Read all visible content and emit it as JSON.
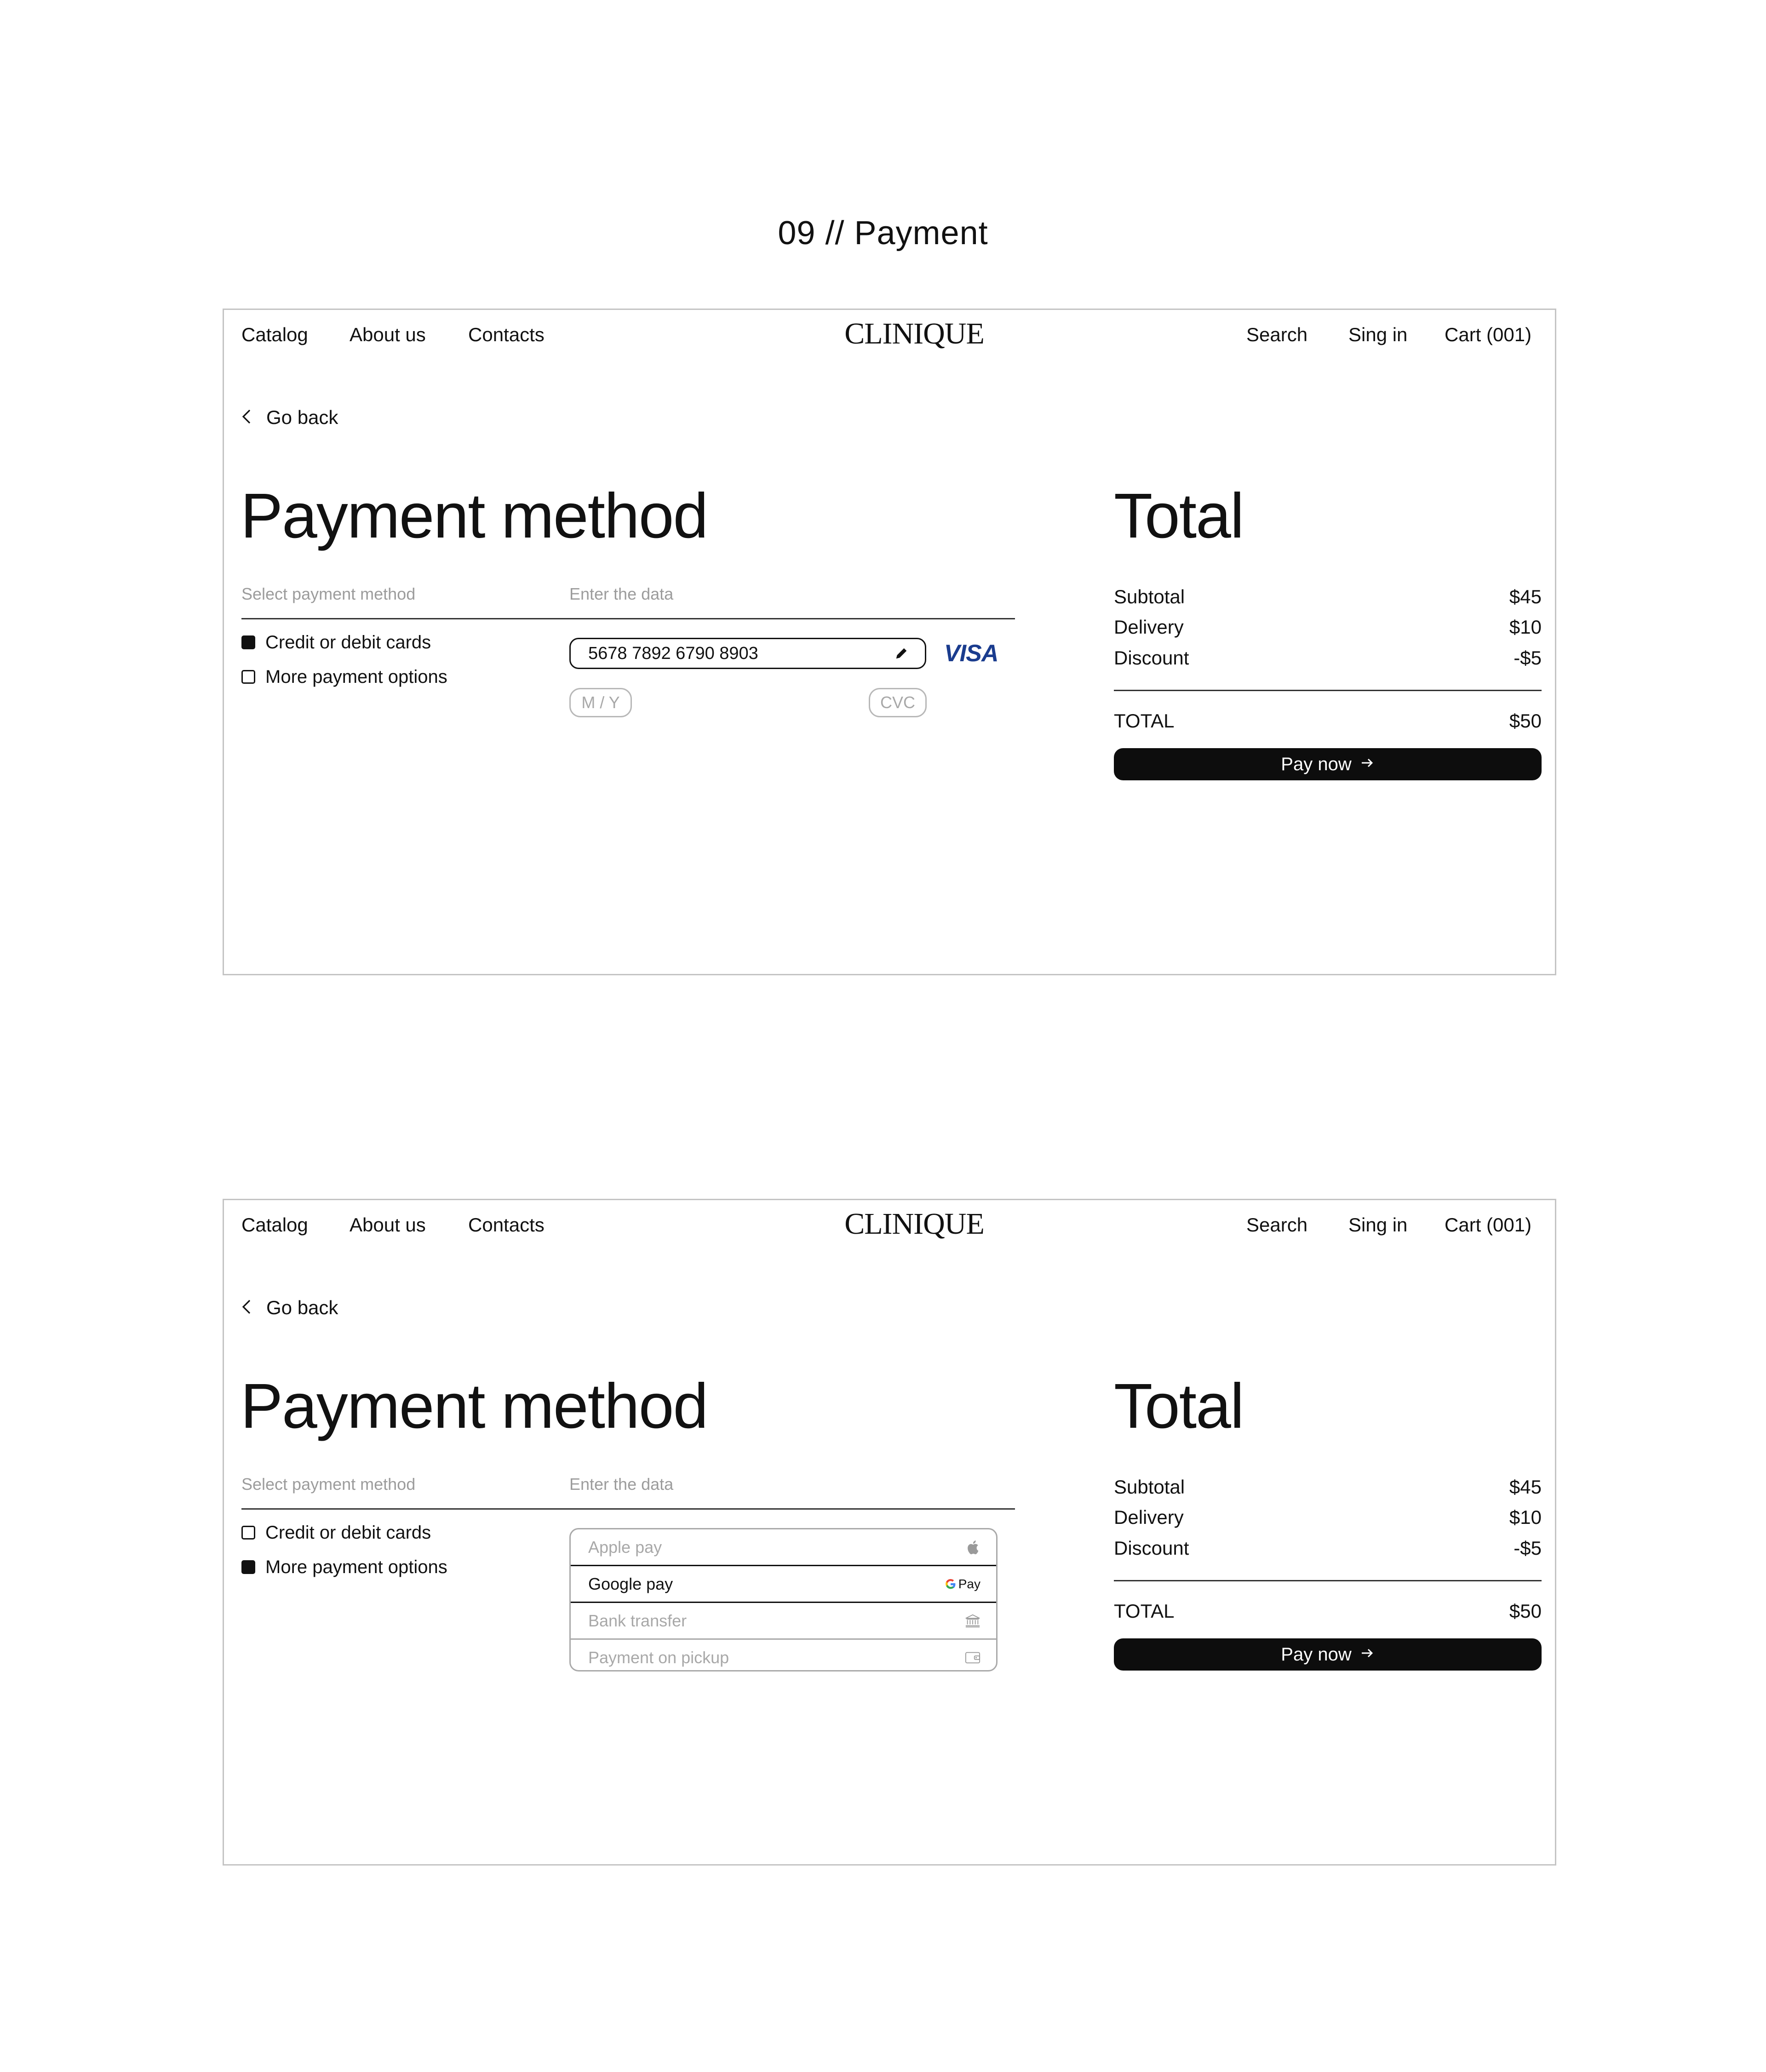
{
  "page_heading": "09 // Payment",
  "screens": [
    {
      "nav": {
        "left": [
          "Catalog",
          "About us",
          "Contacts"
        ],
        "logo": "CLINIQUE",
        "right": [
          "Search",
          "Sing in",
          "Cart (001)"
        ]
      },
      "go_back": "Go back",
      "payment_title": "Payment method",
      "total_title": "Total",
      "select_label": "Select payment method",
      "data_label": "Enter the data",
      "methods": [
        {
          "label": "Credit or debit cards",
          "checked": true
        },
        {
          "label": "More payment options",
          "checked": false
        }
      ],
      "card": {
        "number": "5678 7892 6790 8903",
        "brand": "VISA",
        "expiry_placeholder": "M / Y",
        "cvc_placeholder": "CVC"
      },
      "summary": [
        {
          "label": "Subtotal",
          "value": "$45"
        },
        {
          "label": "Delivery",
          "value": "$10"
        },
        {
          "label": "Discount",
          "value": "-$5"
        }
      ],
      "total": {
        "label": "TOTAL",
        "value": "$50"
      },
      "pay_button": "Pay now"
    },
    {
      "nav": {
        "left": [
          "Catalog",
          "About us",
          "Contacts"
        ],
        "logo": "CLINIQUE",
        "right": [
          "Search",
          "Sing in",
          "Cart (001)"
        ]
      },
      "go_back": "Go back",
      "payment_title": "Payment method",
      "total_title": "Total",
      "select_label": "Select payment method",
      "data_label": "Enter the data",
      "methods": [
        {
          "label": "Credit or debit cards",
          "checked": false
        },
        {
          "label": "More payment options",
          "checked": true
        }
      ],
      "payment_options": [
        {
          "label": "Apple pay",
          "icon": "apple-icon",
          "selected": false
        },
        {
          "label": "Google pay",
          "icon": "google-pay-icon",
          "icon_text": "Pay",
          "selected": true
        },
        {
          "label": "Bank transfer",
          "icon": "bank-icon",
          "selected": false
        },
        {
          "label": "Payment on pickup",
          "icon": "wallet-icon",
          "selected": false
        }
      ],
      "summary": [
        {
          "label": "Subtotal",
          "value": "$45"
        },
        {
          "label": "Delivery",
          "value": "$10"
        },
        {
          "label": "Discount",
          "value": "-$5"
        }
      ],
      "total": {
        "label": "TOTAL",
        "value": "$50"
      },
      "pay_button": "Pay now"
    }
  ]
}
